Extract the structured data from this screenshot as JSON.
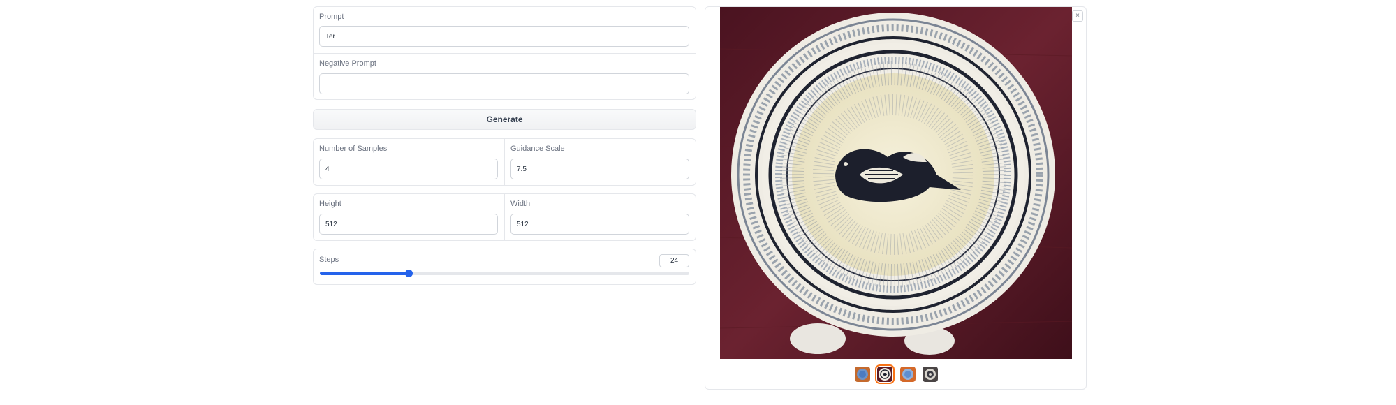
{
  "prompt": {
    "label": "Prompt",
    "value": "Ter"
  },
  "negative_prompt": {
    "label": "Negative Prompt",
    "value": ""
  },
  "generate": {
    "label": "Generate"
  },
  "samples": {
    "label": "Number of Samples",
    "value": "4"
  },
  "guidance": {
    "label": "Guidance Scale",
    "value": "7.5"
  },
  "height": {
    "label": "Height",
    "value": "512"
  },
  "width": {
    "label": "Width",
    "value": "512"
  },
  "steps": {
    "label": "Steps",
    "value": "24",
    "fraction": 0.24
  },
  "gallery": {
    "close_icon": "close-icon",
    "close_glyph": "×",
    "selected_index": 1,
    "thumbnail_count": 4,
    "accent_color": "#f97316"
  },
  "colors": {
    "accent": "#2563eb",
    "selected": "#f97316",
    "table": "#5a1a24"
  }
}
